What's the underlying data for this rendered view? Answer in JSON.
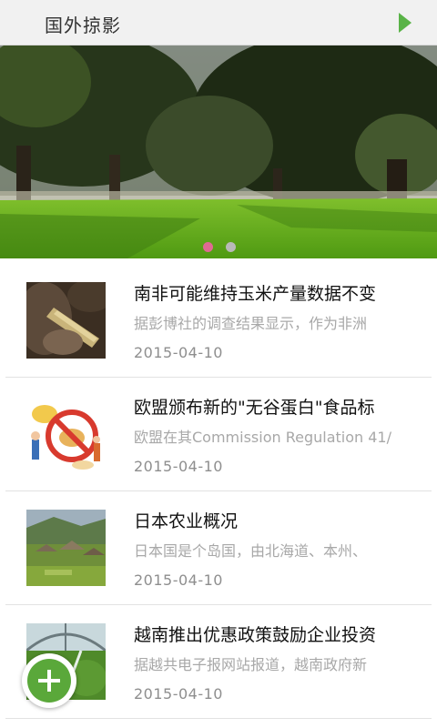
{
  "header": {
    "title": "国外掠影",
    "forward_icon": "play-arrow-icon",
    "accent": "#59b347"
  },
  "banner": {
    "slide_count": 2,
    "active_slide": 1,
    "active_dot_color": "#e06a93",
    "inactive_dot_color": "#b9b9b9"
  },
  "articles": [
    {
      "title": "南非可能维持玉米产量数据不变",
      "summary": "据彭博社的调查结果显示，作为非洲",
      "date": "2015-04-10",
      "thumb": "corn-photo"
    },
    {
      "title": "欧盟颁布新的\"无谷蛋白\"食品标",
      "summary": "欧盟在其Commission Regulation 41/",
      "date": "2015-04-10",
      "thumb": "no-gluten-illustration"
    },
    {
      "title": "日本农业概况",
      "summary": "日本国是个岛国，由北海道、本州、",
      "date": "2015-04-10",
      "thumb": "village-photo"
    },
    {
      "title": "越南推出优惠政策鼓励企业投资",
      "summary": "据越共电子报网站报道，越南政府新",
      "date": "2015-04-10",
      "thumb": "greenhouse-photo"
    }
  ],
  "fab": {
    "icon": "plus-icon",
    "color": "#5aa83a"
  }
}
